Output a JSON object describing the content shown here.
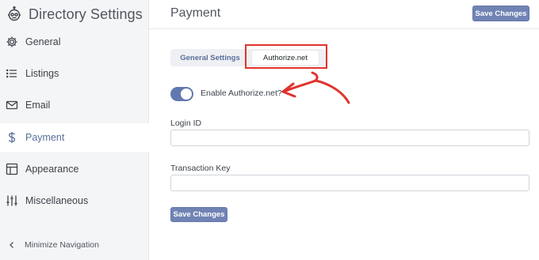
{
  "sidebar": {
    "title": "Directory Settings",
    "logo_icon": "robot-logo-icon",
    "items": [
      {
        "label": "General",
        "icon": "gear-icon"
      },
      {
        "label": "Listings",
        "icon": "list-icon"
      },
      {
        "label": "Email",
        "icon": "envelope-icon"
      },
      {
        "label": "Payment",
        "icon": "dollar-icon",
        "active": true
      },
      {
        "label": "Appearance",
        "icon": "layout-icon"
      },
      {
        "label": "Miscellaneous",
        "icon": "sliders-icon"
      }
    ],
    "minimize_label": "Minimize Navigation"
  },
  "header": {
    "title": "Payment",
    "save_label": "Save Changes"
  },
  "tabs": [
    {
      "label": "General Settings",
      "active": false
    },
    {
      "label": "Authorize.net",
      "active": true
    }
  ],
  "toggle": {
    "label": "Enable Authorize.net?",
    "enabled": true
  },
  "fields": {
    "login_id": {
      "label": "Login ID",
      "value": "",
      "placeholder": ""
    },
    "transaction_key": {
      "label": "Transaction Key",
      "value": "",
      "placeholder": ""
    }
  },
  "footer": {
    "save_label": "Save Changes"
  },
  "colors": {
    "accent": "#7083b4",
    "annotation": "#e0332d",
    "sidebar_bg": "#f4f5f7"
  }
}
